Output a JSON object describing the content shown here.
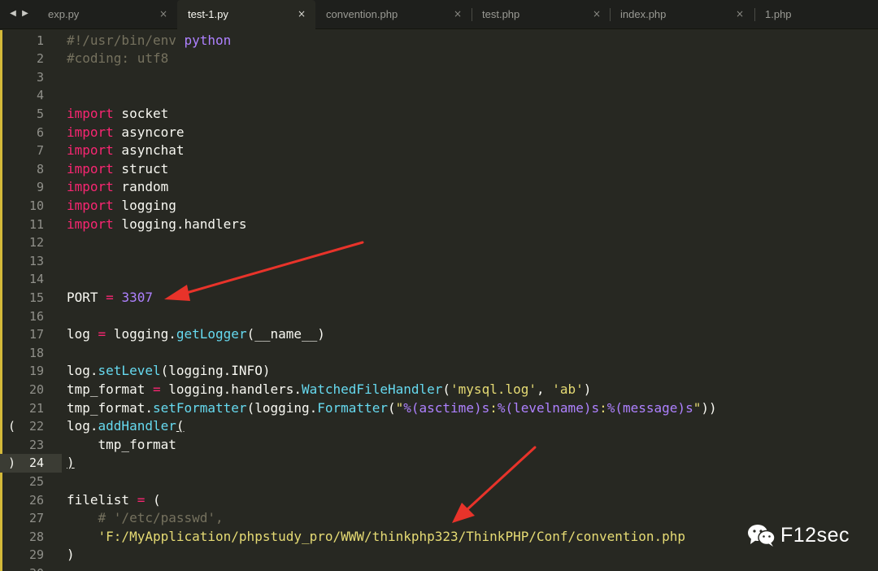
{
  "navigation": {
    "back_icon": "triangle-left-icon",
    "forward_icon": "triangle-right-icon"
  },
  "tabs": [
    {
      "label": "exp.py",
      "active": false,
      "close": "×"
    },
    {
      "label": "test-1.py",
      "active": true,
      "close": "×"
    },
    {
      "label": "convention.php",
      "active": false,
      "close": "×"
    },
    {
      "label": "test.php",
      "active": false,
      "close": "×"
    },
    {
      "label": "index.php",
      "active": false,
      "close": "×"
    },
    {
      "label": "1.php",
      "active": false,
      "close": ""
    }
  ],
  "editor": {
    "current_line": 24,
    "lines": [
      {
        "num": "1",
        "tokens": [
          [
            "c",
            "#!/usr/bin/env "
          ],
          [
            "ph",
            "python"
          ]
        ]
      },
      {
        "num": "2",
        "tokens": [
          [
            "c",
            "#coding: utf8"
          ]
        ]
      },
      {
        "num": "3",
        "tokens": []
      },
      {
        "num": "4",
        "tokens": []
      },
      {
        "num": "5",
        "tokens": [
          [
            "kw",
            "import"
          ],
          [
            "p",
            " socket"
          ]
        ]
      },
      {
        "num": "6",
        "tokens": [
          [
            "kw",
            "import"
          ],
          [
            "p",
            " asyncore"
          ]
        ]
      },
      {
        "num": "7",
        "tokens": [
          [
            "kw",
            "import"
          ],
          [
            "p",
            " asynchat"
          ]
        ]
      },
      {
        "num": "8",
        "tokens": [
          [
            "kw",
            "import"
          ],
          [
            "p",
            " struct"
          ]
        ]
      },
      {
        "num": "9",
        "tokens": [
          [
            "kw",
            "import"
          ],
          [
            "p",
            " random"
          ]
        ]
      },
      {
        "num": "10",
        "tokens": [
          [
            "kw",
            "import"
          ],
          [
            "p",
            " logging"
          ]
        ]
      },
      {
        "num": "11",
        "tokens": [
          [
            "kw",
            "import"
          ],
          [
            "p",
            " logging.handlers"
          ]
        ]
      },
      {
        "num": "12",
        "tokens": []
      },
      {
        "num": "13",
        "tokens": []
      },
      {
        "num": "14",
        "tokens": []
      },
      {
        "num": "15",
        "tokens": [
          [
            "p",
            "PORT "
          ],
          [
            "kw",
            "="
          ],
          [
            "p",
            " "
          ],
          [
            "n",
            "3307"
          ]
        ]
      },
      {
        "num": "16",
        "tokens": []
      },
      {
        "num": "17",
        "tokens": [
          [
            "p",
            "log "
          ],
          [
            "kw",
            "="
          ],
          [
            "p",
            " logging."
          ],
          [
            "fn",
            "getLogger"
          ],
          [
            "p",
            "(__name__)"
          ]
        ]
      },
      {
        "num": "18",
        "tokens": []
      },
      {
        "num": "19",
        "tokens": [
          [
            "p",
            "log."
          ],
          [
            "fn",
            "setLevel"
          ],
          [
            "p",
            "(logging.INFO)"
          ]
        ]
      },
      {
        "num": "20",
        "tokens": [
          [
            "p",
            "tmp_format "
          ],
          [
            "kw",
            "="
          ],
          [
            "p",
            " logging.handlers."
          ],
          [
            "fn",
            "WatchedFileHandler"
          ],
          [
            "p",
            "("
          ],
          [
            "s",
            "'mysql.log'"
          ],
          [
            "p",
            ", "
          ],
          [
            "s",
            "'ab'"
          ],
          [
            "p",
            ")"
          ]
        ]
      },
      {
        "num": "21",
        "tokens": [
          [
            "p",
            "tmp_format."
          ],
          [
            "fn",
            "setFormatter"
          ],
          [
            "p",
            "(logging."
          ],
          [
            "fn",
            "Formatter"
          ],
          [
            "p",
            "("
          ],
          [
            "s",
            "\""
          ],
          [
            "ph",
            "%(asctime)s"
          ],
          [
            "s",
            ":"
          ],
          [
            "ph",
            "%(levelname)s"
          ],
          [
            "s",
            ":"
          ],
          [
            "ph",
            "%(message)s"
          ],
          [
            "s",
            "\""
          ],
          [
            "p",
            "))"
          ]
        ]
      },
      {
        "num": "22",
        "fold": "(",
        "tokens": [
          [
            "p",
            "log."
          ],
          [
            "fn",
            "addHandler"
          ],
          [
            "u",
            "("
          ]
        ]
      },
      {
        "num": "23",
        "tokens": [
          [
            "p",
            "    tmp_format"
          ]
        ]
      },
      {
        "num": "24",
        "fold": ")",
        "tokens": [
          [
            "u",
            ")"
          ]
        ]
      },
      {
        "num": "25",
        "tokens": []
      },
      {
        "num": "26",
        "tokens": [
          [
            "p",
            "filelist "
          ],
          [
            "kw",
            "="
          ],
          [
            "p",
            " ("
          ]
        ]
      },
      {
        "num": "27",
        "tokens": [
          [
            "p",
            "    "
          ],
          [
            "c",
            "# '/etc/passwd',"
          ]
        ]
      },
      {
        "num": "28",
        "tokens": [
          [
            "p",
            "    "
          ],
          [
            "s",
            "'F:/MyApplication/phpstudy_pro/WWW/thinkphp323/ThinkPHP/Conf/convention.php"
          ]
        ]
      },
      {
        "num": "29",
        "tokens": [
          [
            "p",
            ")"
          ]
        ]
      },
      {
        "num": "30",
        "tokens": []
      }
    ]
  },
  "annotations": {
    "arrow_color": "#e8332a",
    "arrow_icons": [
      "arrow-to-port-icon",
      "arrow-to-path-icon"
    ]
  },
  "watermark": {
    "icon": "wechat-icon",
    "text": "F12sec"
  },
  "colors": {
    "background": "#272822",
    "keyword": "#f92672",
    "string": "#e6db74",
    "function": "#66d9ef",
    "number": "#ae81ff",
    "comment": "#75715e"
  }
}
